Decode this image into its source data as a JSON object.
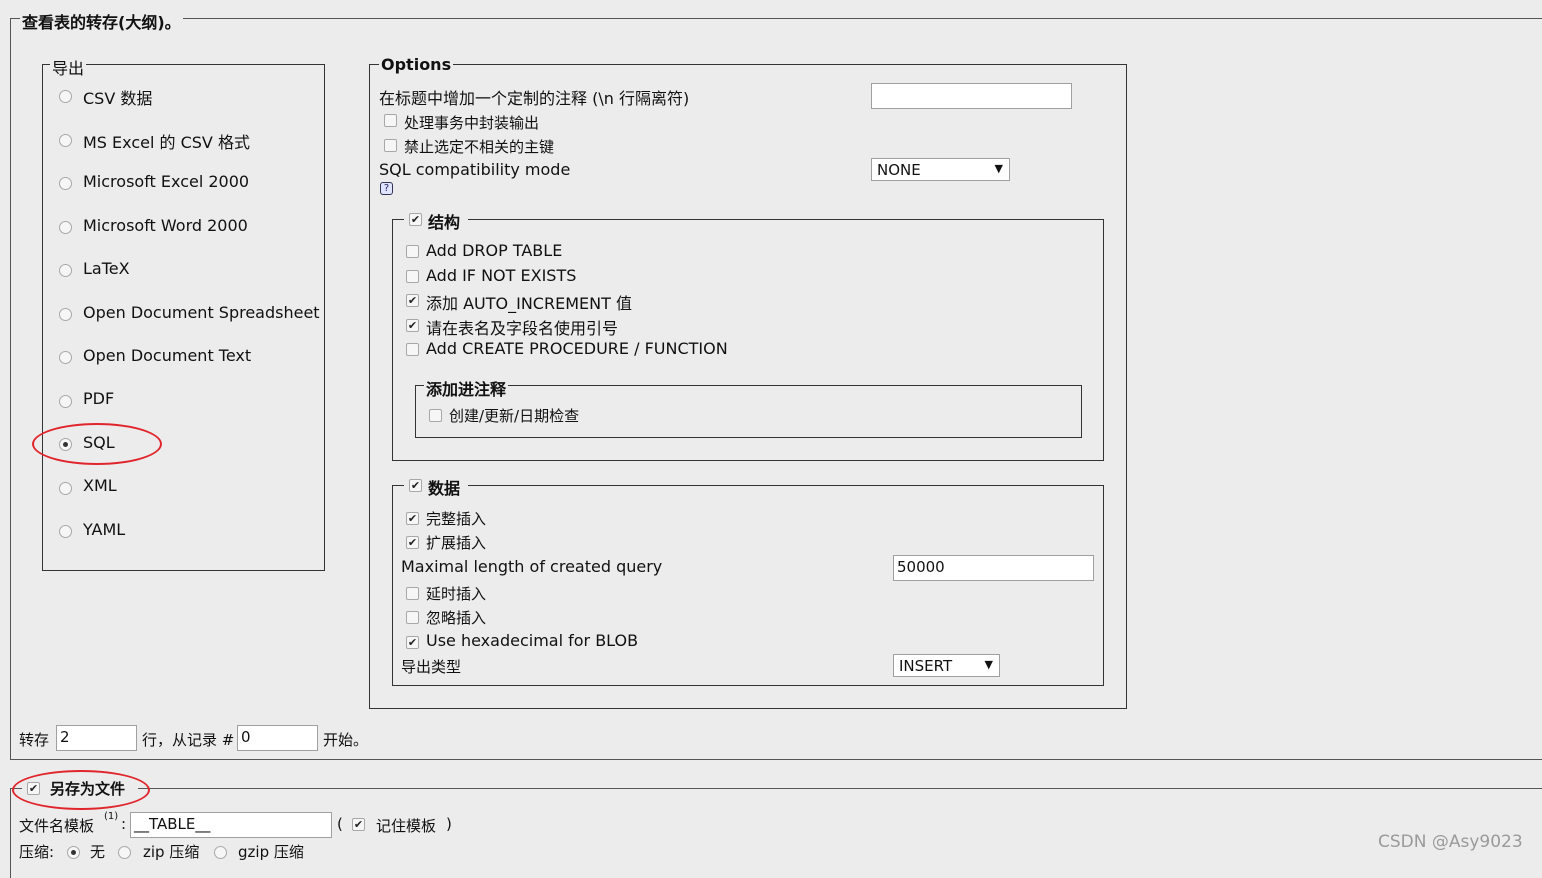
{
  "outer_legend": "查看表的转存(大纲)。",
  "export": {
    "legend": "导出",
    "selected": "SQL",
    "formats": [
      "CSV 数据",
      "MS Excel 的 CSV 格式",
      "Microsoft Excel 2000",
      "Microsoft Word 2000",
      "LaTeX",
      "Open Document Spreadsheet",
      "Open Document Text",
      "PDF",
      "SQL",
      "XML",
      "YAML"
    ]
  },
  "options": {
    "legend": "Options",
    "header_comment_label": "在标题中增加一个定制的注释 (\\n 行隔离符)",
    "header_comment_value": "",
    "wrap_transaction": {
      "label": "处理事务中封装输出",
      "checked": false
    },
    "disable_fk": {
      "label": "禁止选定不相关的主键",
      "checked": false
    },
    "compat_label": "SQL compatibility mode",
    "compat_value": "NONE",
    "help_icon": "?",
    "structure": {
      "legend": "结构",
      "checked": true,
      "items": [
        {
          "label": "Add DROP TABLE",
          "checked": false
        },
        {
          "label": "Add IF NOT EXISTS",
          "checked": false
        },
        {
          "label": "添加 AUTO_INCREMENT 值",
          "checked": true
        },
        {
          "label": "请在表名及字段名使用引号",
          "checked": true
        },
        {
          "label": "Add CREATE PROCEDURE / FUNCTION",
          "checked": false
        }
      ],
      "comments": {
        "legend": "添加进注释",
        "item": {
          "label": "创建/更新/日期检查",
          "checked": false
        }
      }
    },
    "data": {
      "legend": "数据",
      "checked": true,
      "complete_insert": {
        "label": "完整插入",
        "checked": true
      },
      "extended_insert": {
        "label": "扩展插入",
        "checked": true
      },
      "max_query_label": "Maximal length of created query",
      "max_query_value": "50000",
      "delayed_insert": {
        "label": "延时插入",
        "checked": false
      },
      "ignore_insert": {
        "label": "忽略插入",
        "checked": false
      },
      "hex_blob": {
        "label": "Use hexadecimal for BLOB",
        "checked": true
      },
      "export_type_label": "导出类型",
      "export_type_value": "INSERT"
    }
  },
  "dump": {
    "prefix": "转存",
    "rows_value": "2",
    "middle": "行，从记录 #",
    "start_value": "0",
    "suffix": "开始。"
  },
  "save_file": {
    "legend": "另存为文件",
    "checked": true,
    "template_label": "文件名模板",
    "template_sup": "(1)",
    "template_colon": ":",
    "template_value": "__TABLE__",
    "paren_open": "(",
    "remember_label": "记住模板",
    "remember_checked": true,
    "paren_close": ")",
    "compression_label": "压缩:",
    "compression_options": [
      "无",
      "zip 压缩",
      "gzip 压缩"
    ],
    "compression_selected": "无"
  },
  "watermark": "CSDN @Asy9023",
  "annotation_color": "#e0262c"
}
